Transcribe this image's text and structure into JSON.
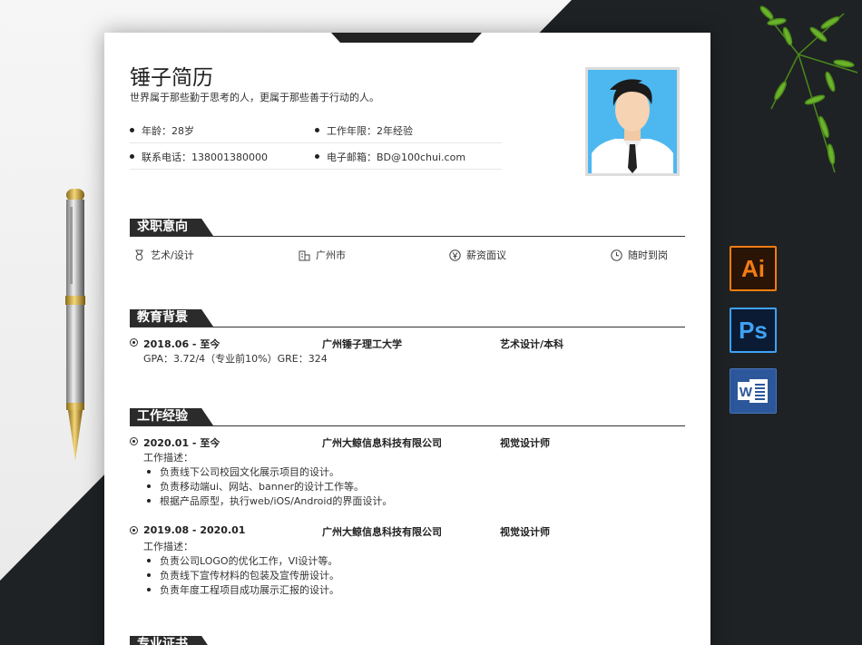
{
  "resume": {
    "name": "锤子简历",
    "motto": "世界属于那些勤于思考的人，更属于那些善于行动的人。",
    "info": {
      "age": "年龄：28岁",
      "years": "工作年限：2年经验",
      "phone": "联系电话：138001380000",
      "email": "电子邮箱：BD@100chui.com"
    }
  },
  "sections": {
    "intent": "求职意向",
    "education": "教育背景",
    "work": "工作经验",
    "next": "专业证书"
  },
  "intent": {
    "field": "艺术/设计",
    "city": "广州市",
    "salary": "薪资面议",
    "availability": "随时到岗"
  },
  "education": {
    "period": "2018.06 - 至今",
    "school": "广州锤子理工大学",
    "major": "艺术设计/本科",
    "gpa": "GPA：3.72/4（专业前10%）GRE：324"
  },
  "work": [
    {
      "period": "2020.01 - 至今",
      "company": "广州大鲸信息科技有限公司",
      "role": "视觉设计师",
      "desc_label": "工作描述：",
      "items": [
        "负责线下公司校园文化展示项目的设计。",
        "负责移动端ui、网站、banner的设计工作等。",
        "根据产品原型，执行web/iOS/Android的界面设计。"
      ]
    },
    {
      "period": "2019.08 - 2020.01",
      "company": "广州大鲸信息科技有限公司",
      "role": "视觉设计师",
      "desc_label": "工作描述：",
      "items": [
        "负责公司LOGO的优化工作，VI设计等。",
        "负责线下宣传材料的包装及宣传册设计。",
        "负责年度工程项目成功展示汇报的设计。"
      ]
    }
  ],
  "apps": {
    "ai": "Ai",
    "ps": "Ps",
    "word": "W"
  },
  "colors": {
    "dark_bg": "#1f2224",
    "section_bar": "#2b2b2b",
    "photo_bg": "#4db8f0",
    "ai": "#f27c13",
    "ps": "#3fa2f7",
    "word": "#2c579a"
  }
}
